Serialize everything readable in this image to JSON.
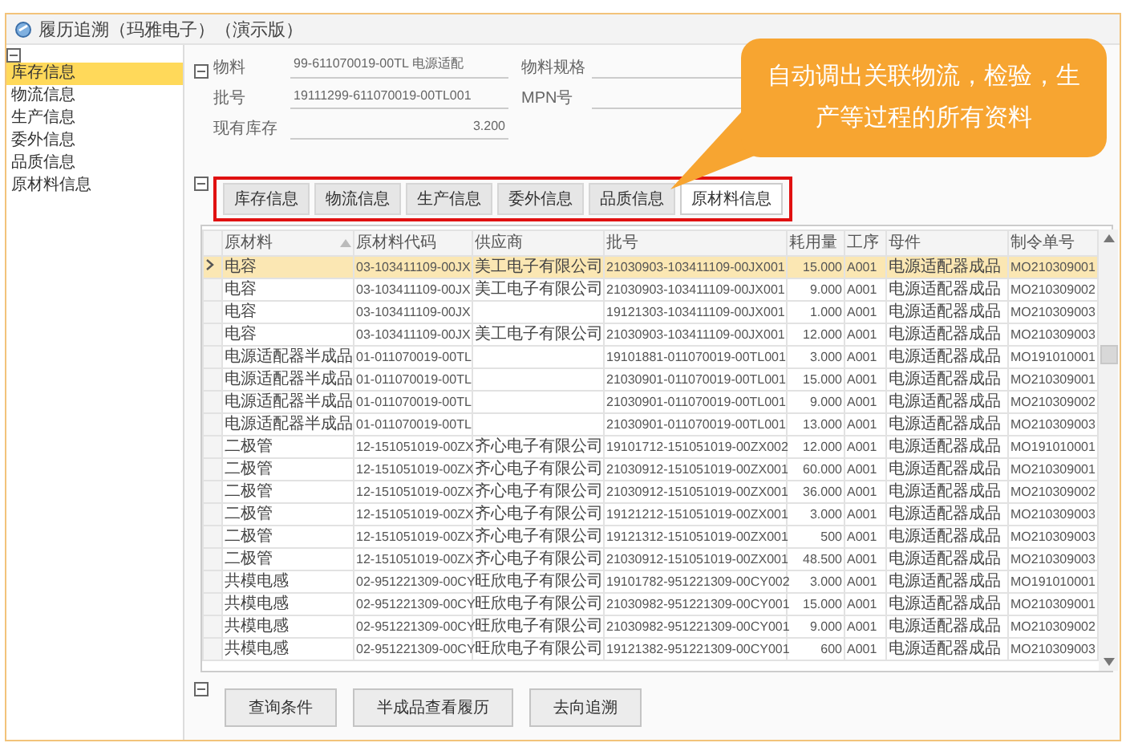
{
  "window": {
    "title": "履历追溯（玛雅电子）（演示版）"
  },
  "sidebar": {
    "items": [
      {
        "label": "库存信息",
        "selected": true
      },
      {
        "label": "物流信息",
        "selected": false
      },
      {
        "label": "生产信息",
        "selected": false
      },
      {
        "label": "委外信息",
        "selected": false
      },
      {
        "label": "品质信息",
        "selected": false
      },
      {
        "label": "原材料信息",
        "selected": false
      }
    ]
  },
  "form": {
    "fields": [
      {
        "label": "物料",
        "value": "99-611070019-00TL 电源适配"
      },
      {
        "label": "批号",
        "value": "19111299-611070019-00TL001"
      },
      {
        "label": "现有库存",
        "value": "3.200"
      }
    ],
    "right_fields": [
      {
        "label": "物料规格"
      },
      {
        "label": "MPN号"
      }
    ]
  },
  "callout": {
    "text": "自动调出关联物流，检验，生产等过程的所有资料"
  },
  "tabs": [
    {
      "label": "库存信息",
      "selected": false
    },
    {
      "label": "物流信息",
      "selected": false
    },
    {
      "label": "生产信息",
      "selected": false
    },
    {
      "label": "委外信息",
      "selected": false
    },
    {
      "label": "品质信息",
      "selected": false
    },
    {
      "label": "原材料信息",
      "selected": true
    }
  ],
  "table": {
    "columns": [
      {
        "label": "原材料",
        "sorted": true
      },
      {
        "label": "原材料代码",
        "sorted": false
      },
      {
        "label": "供应商",
        "sorted": false
      },
      {
        "label": "批号",
        "sorted": false
      },
      {
        "label": "耗用量",
        "sorted": false
      },
      {
        "label": "工序",
        "sorted": false
      },
      {
        "label": "母件",
        "sorted": false
      },
      {
        "label": "制令单号",
        "sorted": false
      }
    ],
    "rows": [
      {
        "selected": true,
        "cells": [
          "电容",
          "03-103411109-00JX",
          "美工电子有限公司",
          "21030903-103411109-00JX001",
          "15.000",
          "A001",
          "电源适配器成品",
          "MO210309001"
        ]
      },
      {
        "selected": false,
        "cells": [
          "电容",
          "03-103411109-00JX",
          "美工电子有限公司",
          "21030903-103411109-00JX001",
          "9.000",
          "A001",
          "电源适配器成品",
          "MO210309002"
        ]
      },
      {
        "selected": false,
        "cells": [
          "电容",
          "03-103411109-00JX",
          "",
          "19121303-103411109-00JX001",
          "1.000",
          "A001",
          "电源适配器成品",
          "MO210309003"
        ]
      },
      {
        "selected": false,
        "cells": [
          "电容",
          "03-103411109-00JX",
          "美工电子有限公司",
          "21030903-103411109-00JX001",
          "12.000",
          "A001",
          "电源适配器成品",
          "MO210309003"
        ]
      },
      {
        "selected": false,
        "cells": [
          "电源适配器半成品",
          "01-011070019-00TL",
          "",
          "19101881-011070019-00TL001",
          "3.000",
          "A001",
          "电源适配器成品",
          "MO191010001"
        ]
      },
      {
        "selected": false,
        "cells": [
          "电源适配器半成品",
          "01-011070019-00TL",
          "",
          "21030901-011070019-00TL001",
          "15.000",
          "A001",
          "电源适配器成品",
          "MO210309001"
        ]
      },
      {
        "selected": false,
        "cells": [
          "电源适配器半成品",
          "01-011070019-00TL",
          "",
          "21030901-011070019-00TL001",
          "9.000",
          "A001",
          "电源适配器成品",
          "MO210309002"
        ]
      },
      {
        "selected": false,
        "cells": [
          "电源适配器半成品",
          "01-011070019-00TL",
          "",
          "21030901-011070019-00TL001",
          "13.000",
          "A001",
          "电源适配器成品",
          "MO210309003"
        ]
      },
      {
        "selected": false,
        "cells": [
          "二极管",
          "12-151051019-00ZX",
          "齐心电子有限公司",
          "19101712-151051019-00ZX002",
          "12.000",
          "A001",
          "电源适配器成品",
          "MO191010001"
        ]
      },
      {
        "selected": false,
        "cells": [
          "二极管",
          "12-151051019-00ZX",
          "齐心电子有限公司",
          "21030912-151051019-00ZX001",
          "60.000",
          "A001",
          "电源适配器成品",
          "MO210309001"
        ]
      },
      {
        "selected": false,
        "cells": [
          "二极管",
          "12-151051019-00ZX",
          "齐心电子有限公司",
          "21030912-151051019-00ZX001",
          "36.000",
          "A001",
          "电源适配器成品",
          "MO210309002"
        ]
      },
      {
        "selected": false,
        "cells": [
          "二极管",
          "12-151051019-00ZX",
          "齐心电子有限公司",
          "19121212-151051019-00ZX001",
          "3.000",
          "A001",
          "电源适配器成品",
          "MO210309003"
        ]
      },
      {
        "selected": false,
        "cells": [
          "二极管",
          "12-151051019-00ZX",
          "齐心电子有限公司",
          "19121312-151051019-00ZX001",
          "500",
          "A001",
          "电源适配器成品",
          "MO210309003"
        ]
      },
      {
        "selected": false,
        "cells": [
          "二极管",
          "12-151051019-00ZX",
          "齐心电子有限公司",
          "21030912-151051019-00ZX001",
          "48.500",
          "A001",
          "电源适配器成品",
          "MO210309003"
        ]
      },
      {
        "selected": false,
        "cells": [
          "共模电感",
          "02-951221309-00CY",
          "旺欣电子有限公司",
          "19101782-951221309-00CY002",
          "3.000",
          "A001",
          "电源适配器成品",
          "MO191010001"
        ]
      },
      {
        "selected": false,
        "cells": [
          "共模电感",
          "02-951221309-00CY",
          "旺欣电子有限公司",
          "21030982-951221309-00CY001",
          "15.000",
          "A001",
          "电源适配器成品",
          "MO210309001"
        ]
      },
      {
        "selected": false,
        "cells": [
          "共模电感",
          "02-951221309-00CY",
          "旺欣电子有限公司",
          "21030982-951221309-00CY001",
          "9.000",
          "A001",
          "电源适配器成品",
          "MO210309002"
        ]
      },
      {
        "selected": false,
        "cells": [
          "共模电感",
          "02-951221309-00CY",
          "旺欣电子有限公司",
          "19121382-951221309-00CY001",
          "600",
          "A001",
          "电源适配器成品",
          "MO210309003"
        ]
      }
    ]
  },
  "buttons": [
    "查询条件",
    "半成品查看履历",
    "去向追溯"
  ]
}
